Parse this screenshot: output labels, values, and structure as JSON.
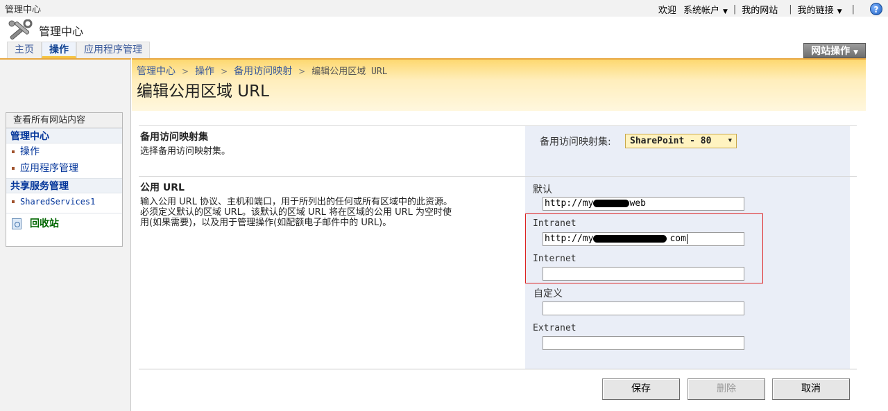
{
  "topbar": {
    "site_label": "管理中心",
    "welcome": "欢迎",
    "account": "系统帐户",
    "my_site": "我的网站",
    "my_links": "我的链接",
    "help": "?"
  },
  "header": {
    "title": "管理中心",
    "tabs": [
      {
        "label": "主页",
        "active": false
      },
      {
        "label": "操作",
        "active": true
      },
      {
        "label": "应用程序管理",
        "active": false
      }
    ],
    "site_actions": "网站操作"
  },
  "quicklaunch": {
    "view_all": "查看所有网站内容",
    "groups": [
      {
        "title": "管理中心",
        "items": [
          "操作",
          "应用程序管理"
        ]
      },
      {
        "title": "共享服务管理",
        "items": [
          "SharedServices1"
        ]
      }
    ],
    "recycle_bin": "回收站"
  },
  "page": {
    "breadcrumb": [
      "管理中心",
      "操作",
      "备用访问映射",
      "编辑公用区域 URL"
    ],
    "title": "编辑公用区域 URL"
  },
  "form": {
    "mapping_section": {
      "title": "备用访问映射集",
      "description": "选择备用访问映射集。",
      "label": "备用访问映射集:",
      "selected": "SharePoint - 80"
    },
    "url_section": {
      "title": "公用 URL",
      "description_lines": [
        "输入公用 URL 协议、主机和端口，用于所列出的任何或所有区域中的此资源。",
        "必须定义默认的区域 URL。该默认的区域 URL 将在区域的公用 URL 为空时使",
        "用(如果需要)，以及用于管理操作(如配额电子邮件中的 URL)。"
      ],
      "zones": [
        {
          "label": "默认",
          "value_prefix": "http://my",
          "value_suffix": "web"
        },
        {
          "label": "Intranet",
          "value_prefix": "http://my",
          "value_suffix": "com"
        },
        {
          "label": "Internet",
          "value_prefix": "",
          "value_suffix": ""
        },
        {
          "label": "自定义",
          "value_prefix": "",
          "value_suffix": ""
        },
        {
          "label": "Extranet",
          "value_prefix": "",
          "value_suffix": ""
        }
      ]
    },
    "buttons": {
      "save": "保存",
      "delete": "删除",
      "cancel": "取消"
    }
  },
  "colors": {
    "accent_gold": "#fdd870",
    "link_blue": "#003399",
    "highlight_red": "#dd2222",
    "panel_blue": "#eaeef7"
  }
}
